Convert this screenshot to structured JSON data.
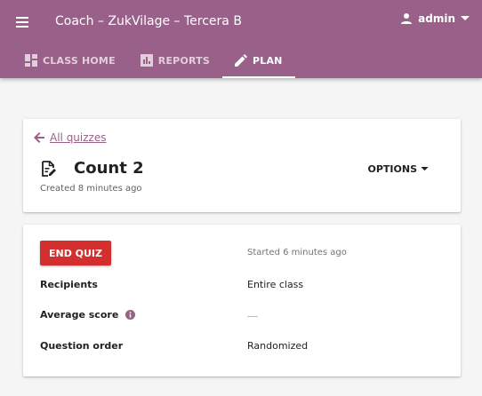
{
  "appbar": {
    "title": "Coach – ZukVilage – Tercera B",
    "user": "admin",
    "color": "#996189"
  },
  "tabs": [
    {
      "label": "CLASS HOME",
      "icon": "dashboard-icon",
      "active": false
    },
    {
      "label": "REPORTS",
      "icon": "bar-chart-icon",
      "active": false
    },
    {
      "label": "PLAN",
      "icon": "pencil-icon",
      "active": true
    }
  ],
  "header_card": {
    "back_label": "All quizzes",
    "title": "Count 2",
    "created": "Created 8 minutes ago",
    "options_label": "OPTIONS"
  },
  "status_card": {
    "end_button": "END QUIZ",
    "started": "Started 6 minutes ago",
    "rows": [
      {
        "label": "Recipients",
        "value": "Entire class"
      },
      {
        "label": "Average score",
        "value": "—"
      },
      {
        "label": "Question order",
        "value": "Randomized"
      }
    ]
  },
  "colors": {
    "accent": "#996189",
    "danger": "#d32f2f"
  }
}
